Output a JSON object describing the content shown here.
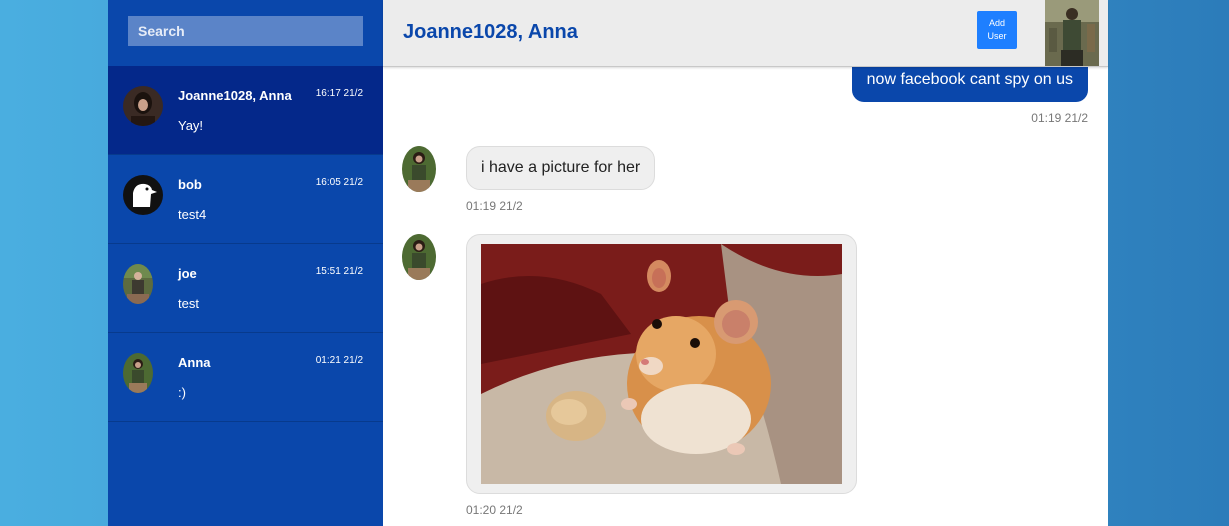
{
  "sidebar": {
    "search_placeholder": "Search",
    "conversations": [
      {
        "name": "Joanne1028, Anna",
        "time": "16:17 21/2",
        "preview": "Yay!",
        "active": true
      },
      {
        "name": "bob",
        "time": "16:05 21/2",
        "preview": "test4",
        "active": false
      },
      {
        "name": "joe",
        "time": "15:51 21/2",
        "preview": "test",
        "active": false
      },
      {
        "name": "Anna",
        "time": "01:21 21/2",
        "preview": ":)",
        "active": false
      }
    ]
  },
  "header": {
    "title": "Joanne1028, Anna",
    "add_user_label_line1": "Add",
    "add_user_label_line2": "User"
  },
  "messages": [
    {
      "direction": "outgoing",
      "text": "now facebook cant spy on us",
      "time": "01:19 21/2"
    },
    {
      "direction": "incoming",
      "text": "i have a picture for her",
      "time": "01:19 21/2"
    },
    {
      "direction": "incoming",
      "type": "image",
      "image_icon": "hamster-photo",
      "time": "01:20 21/2"
    }
  ],
  "colors": {
    "sidebar": "#0a47ab",
    "sidebar_active": "#04288a",
    "accent": "#1e7fff",
    "outgoing_bubble": "#0a47ab",
    "incoming_bubble": "#efefef"
  }
}
